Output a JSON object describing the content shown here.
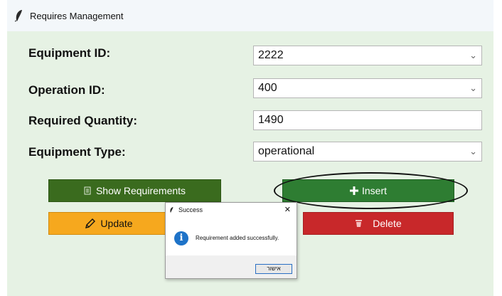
{
  "window": {
    "title": "Requires Management"
  },
  "form": {
    "equipment_id_label": "Equipment ID:",
    "equipment_id_value": "2222",
    "operation_id_label": "Operation ID:",
    "operation_id_value": "400",
    "required_quantity_label": "Required Quantity:",
    "required_quantity_value": "1490",
    "equipment_type_label": "Equipment Type:",
    "equipment_type_value": "operational"
  },
  "buttons": {
    "show_label": "Show Requirements",
    "insert_label": "Insert",
    "update_label": "Update",
    "delete_label": "Delete"
  },
  "dialog": {
    "title": "Success",
    "close": "✕",
    "message": "Requirement added successfully.",
    "ok_label": "אישור"
  },
  "colors": {
    "window_bg": "#e6f2e4",
    "show_button": "#3a6b1e",
    "insert_button": "#2e7d32",
    "update_button": "#f6a81e",
    "delete_button": "#c8282a",
    "info_icon": "#1e73c8"
  },
  "icons": {
    "window": "feather-icon",
    "show": "document-icon",
    "insert": "plus-icon",
    "update": "pencil-icon",
    "delete": "trash-icon",
    "dialog": "info-icon"
  }
}
